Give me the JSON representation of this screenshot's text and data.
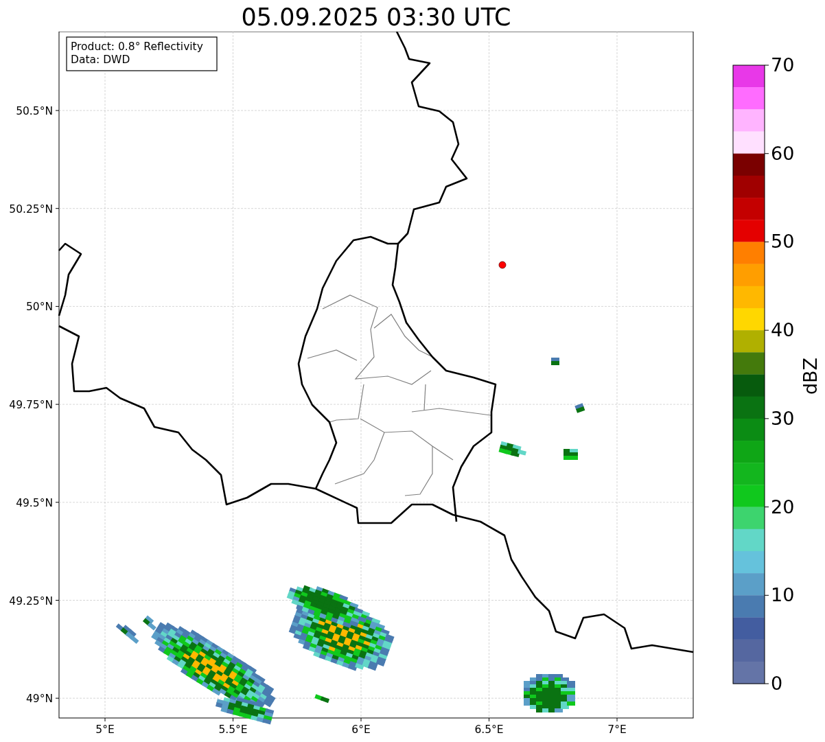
{
  "title": "05.09.2025 03:30 UTC",
  "legend": [
    "Product: 0.8° Reflectivity",
    "Data: DWD"
  ],
  "latitude_ticks": [
    "50.5°N",
    "50.25°N",
    "50°N",
    "49.75°N",
    "49.5°N",
    "49.25°N",
    "49°N"
  ],
  "longitude_ticks": [
    "5°E",
    "5.5°E",
    "6°E",
    "6.5°E",
    "7°E"
  ],
  "colorbar": {
    "label": "dBZ",
    "ticks": [
      "70",
      "60",
      "50",
      "40",
      "30",
      "20",
      "10",
      "0"
    ],
    "segments": [
      {
        "color": "#e838e8"
      },
      {
        "color": "#ff6cff"
      },
      {
        "color": "#ffb4ff"
      },
      {
        "color": "#ffe0ff"
      },
      {
        "color": "#7a0000"
      },
      {
        "color": "#a00000"
      },
      {
        "color": "#c40000"
      },
      {
        "color": "#e40000"
      },
      {
        "color": "#ff7f00"
      },
      {
        "color": "#ff9e00"
      },
      {
        "color": "#ffb800"
      },
      {
        "color": "#ffd700"
      },
      {
        "color": "#b0b000"
      },
      {
        "color": "#447a0c"
      },
      {
        "color": "#075b0d"
      },
      {
        "color": "#0a7312"
      },
      {
        "color": "#0b8c14"
      },
      {
        "color": "#0fa616"
      },
      {
        "color": "#13b61e"
      },
      {
        "color": "#10c81d"
      },
      {
        "color": "#3dd46e"
      },
      {
        "color": "#62d7c7"
      },
      {
        "color": "#65c2dc"
      },
      {
        "color": "#5b9fc8"
      },
      {
        "color": "#4a7bb0"
      },
      {
        "color": "#435da0"
      },
      {
        "color": "#5567a0"
      },
      {
        "color": "#6474a7"
      }
    ]
  }
}
